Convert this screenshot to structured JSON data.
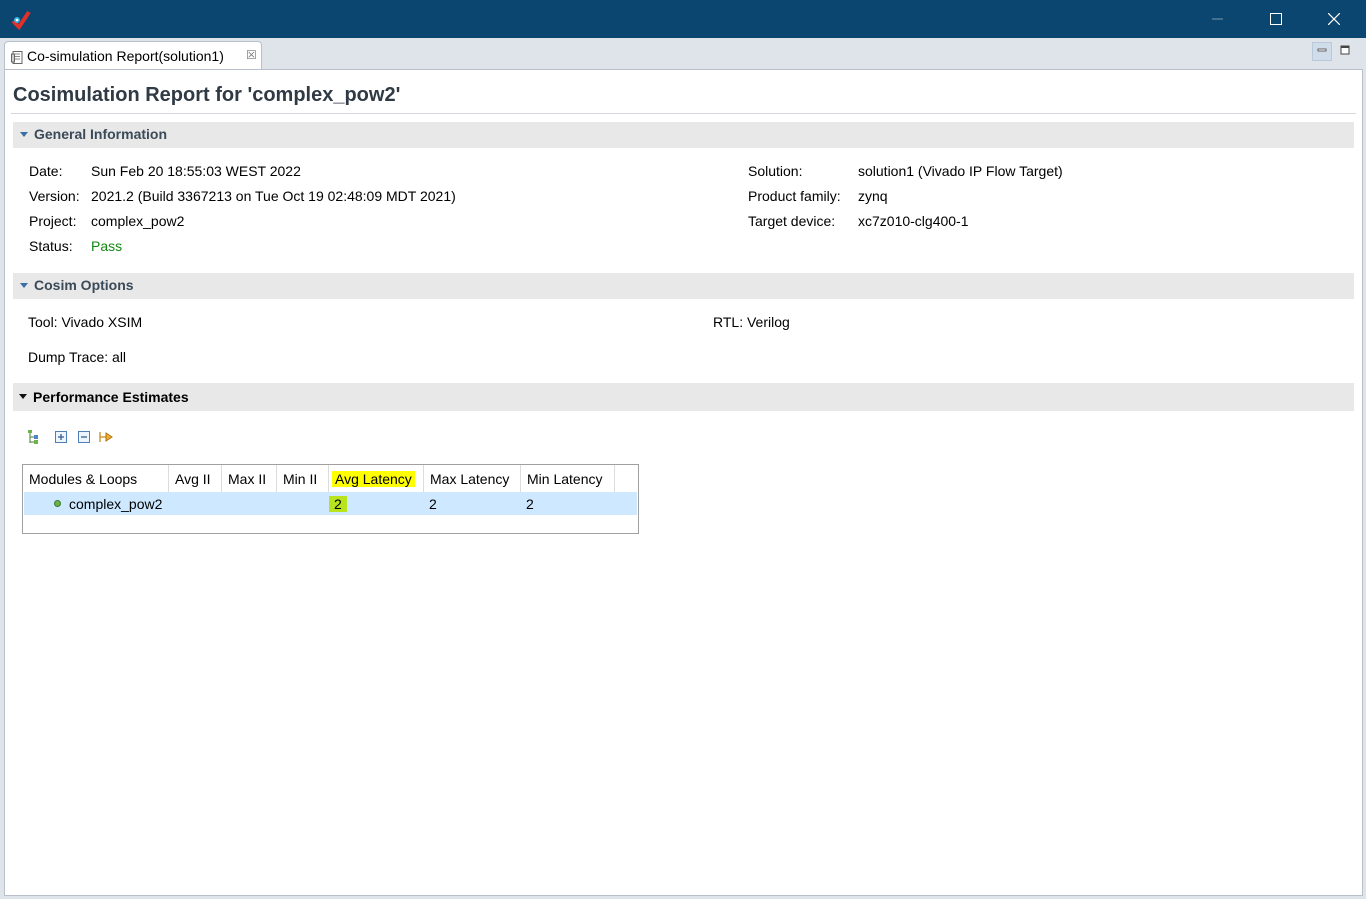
{
  "window": {
    "tab_label": "Co-simulation Report(solution1)",
    "colors": {
      "titlebar": "#0a4670",
      "pass": "#118811",
      "highlight": "#ffff00",
      "selection": "#cde8ff"
    }
  },
  "report": {
    "title": "Cosimulation Report for 'complex_pow2'",
    "general": {
      "header": "General Information",
      "date_label": "Date:",
      "date_value": "Sun Feb 20 18:55:03 WEST 2022",
      "version_label": "Version:",
      "version_value": "2021.2 (Build 3367213 on Tue Oct 19 02:48:09 MDT 2021)",
      "project_label": "Project:",
      "project_value": "complex_pow2",
      "status_label": "Status:",
      "status_value": "Pass",
      "solution_label": "Solution:",
      "solution_value": "solution1 (Vivado IP Flow Target)",
      "family_label": "Product family:",
      "family_value": "zynq",
      "device_label": "Target device:",
      "device_value": "xc7z010-clg400-1"
    },
    "cosim": {
      "header": "Cosim Options",
      "tool": "Tool: Vivado XSIM",
      "rtl": "RTL: Verilog",
      "dump": "Dump Trace: all"
    },
    "perf": {
      "header": "Performance Estimates",
      "toolbar_icons": [
        "hierarchy-icon",
        "expand-all-icon",
        "collapse-all-icon",
        "goto-icon"
      ],
      "columns": [
        "Modules & Loops",
        "Avg II",
        "Max II",
        "Min II",
        "Avg Latency",
        "Max Latency",
        "Min Latency"
      ],
      "rows": [
        {
          "module": "complex_pow2",
          "avg_ii": "",
          "max_ii": "",
          "min_ii": "",
          "avg_latency": "2",
          "max_latency": "2",
          "min_latency": "2"
        }
      ]
    }
  }
}
